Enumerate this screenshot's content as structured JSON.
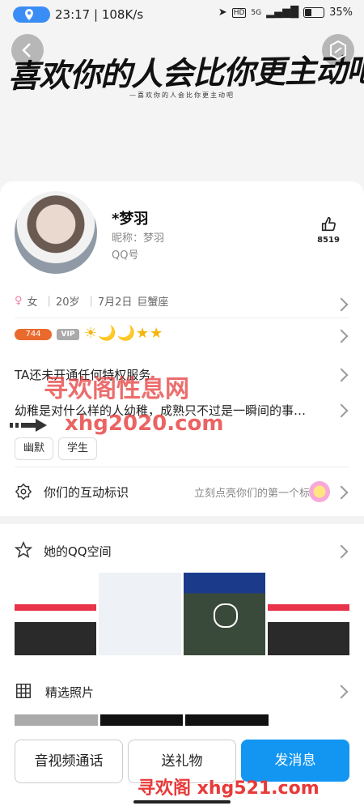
{
  "status": {
    "time": "23:17",
    "net_speed": "108K/s",
    "network": "5G",
    "battery": "35%"
  },
  "header": {
    "banner": "喜欢你的人会比你更主动吧",
    "banner_sub": "—喜欢你的人会比你更主动吧"
  },
  "profile": {
    "name": "*梦羽",
    "nickname": "昵称：梦羽",
    "qq": "QQ号",
    "likes": "8519"
  },
  "info": {
    "gender_icon": "♀",
    "gender": "女",
    "age": "20岁",
    "birthday": "7月2日",
    "zodiac": "巨蟹座"
  },
  "badges": {
    "level": "744",
    "vip": "VIP",
    "glyphs": "☀🌙🌙★★"
  },
  "privilege": "TA还未开通任何特权服务",
  "signature": "幼稚是对什么样的人幼稚，成熟只不过是一瞬间的事…",
  "tags": [
    "幽默",
    "学生"
  ],
  "interaction": {
    "label": "你们的互动标识",
    "hint": "立刻点亮你们的第一个标识"
  },
  "space": {
    "label": "她的QQ空间"
  },
  "photos": {
    "label": "精选照片"
  },
  "actions": {
    "call": "音视频通话",
    "gift": "送礼物",
    "message": "发消息"
  },
  "watermarks": {
    "top": "寻欢阁性息网",
    "middle": "xhg2020.com",
    "bottom": "寻欢阁 xhg521.com"
  }
}
